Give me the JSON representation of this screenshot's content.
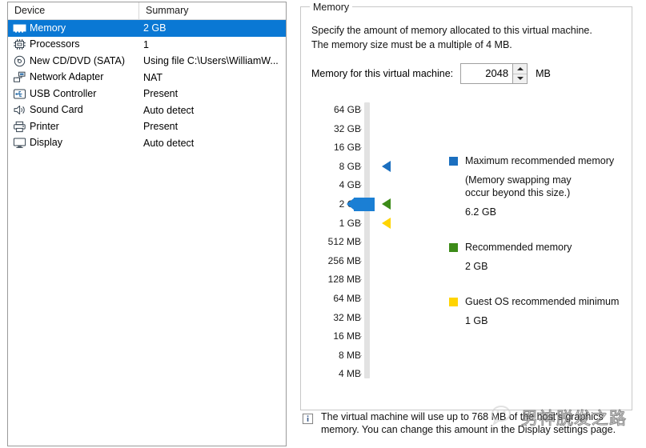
{
  "device_list": {
    "columns": [
      "Device",
      "Summary"
    ],
    "rows": [
      {
        "icon": "memory-module-icon",
        "label": "Memory",
        "summary": "2 GB",
        "selected": true
      },
      {
        "icon": "cpu-chip-icon",
        "label": "Processors",
        "summary": "1",
        "selected": false
      },
      {
        "icon": "cd-dvd-disc-icon",
        "label": "New CD/DVD (SATA)",
        "summary": "Using file C:\\Users\\WilliamW...",
        "selected": false
      },
      {
        "icon": "network-adapter-icon",
        "label": "Network Adapter",
        "summary": "NAT",
        "selected": false
      },
      {
        "icon": "usb-icon",
        "label": "USB Controller",
        "summary": "Present",
        "selected": false
      },
      {
        "icon": "speaker-icon",
        "label": "Sound Card",
        "summary": "Auto detect",
        "selected": false
      },
      {
        "icon": "printer-icon",
        "label": "Printer",
        "summary": "Present",
        "selected": false
      },
      {
        "icon": "display-monitor-icon",
        "label": "Display",
        "summary": "Auto detect",
        "selected": false
      }
    ]
  },
  "memory_panel": {
    "group_title": "Memory",
    "description_line1": "Specify the amount of memory allocated to this virtual machine.",
    "description_line2": "The memory size must be a multiple of 4 MB.",
    "field_label": "Memory for this virtual machine:",
    "field_value": "2048",
    "field_unit": "MB",
    "scale_labels": [
      "64 GB",
      "32 GB",
      "16 GB",
      "8 GB",
      "4 GB",
      "2 GB",
      "1 GB",
      "512 MB",
      "256 MB",
      "128 MB",
      "64 MB",
      "32 MB",
      "16 MB",
      "8 MB",
      "4 MB"
    ],
    "slider": {
      "current_label": "2 GB",
      "thumb_color": "#1b7fd4"
    },
    "markers": [
      {
        "name": "maximum-recommended-marker",
        "color": "#1b6fbf",
        "at_label": "8 GB"
      },
      {
        "name": "recommended-marker",
        "color": "#3c8b18",
        "at_label": "2 GB"
      },
      {
        "name": "guest-os-minimum-marker",
        "color": "#ffd400",
        "at_label": "1 GB"
      }
    ],
    "legend": [
      {
        "swatch_color": "#1b6fbf",
        "title": "Maximum recommended memory",
        "sub_line1": "(Memory swapping may",
        "sub_line2": "occur beyond this size.)",
        "value": "6.2 GB"
      },
      {
        "swatch_color": "#3c8b18",
        "title": "Recommended memory",
        "sub_line1": "",
        "sub_line2": "",
        "value": "2 GB"
      },
      {
        "swatch_color": "#ffd400",
        "title": "Guest OS recommended minimum",
        "sub_line1": "",
        "sub_line2": "",
        "value": "1 GB"
      }
    ]
  },
  "info_note": {
    "icon": "info-icon",
    "text": "The virtual machine will use up to 768 MB of the host's graphics memory. You can change this amount in the Display settings page."
  },
  "watermark": {
    "text": "男神脱发之路",
    "icon": "wechat-icon"
  },
  "colors": {
    "selection_blue": "#0a78d4",
    "slider_blue": "#1b7fd4",
    "legend_blue": "#1b6fbf",
    "legend_green": "#3c8b18",
    "legend_yellow": "#ffd400",
    "track_gray": "#e2e2e2"
  }
}
